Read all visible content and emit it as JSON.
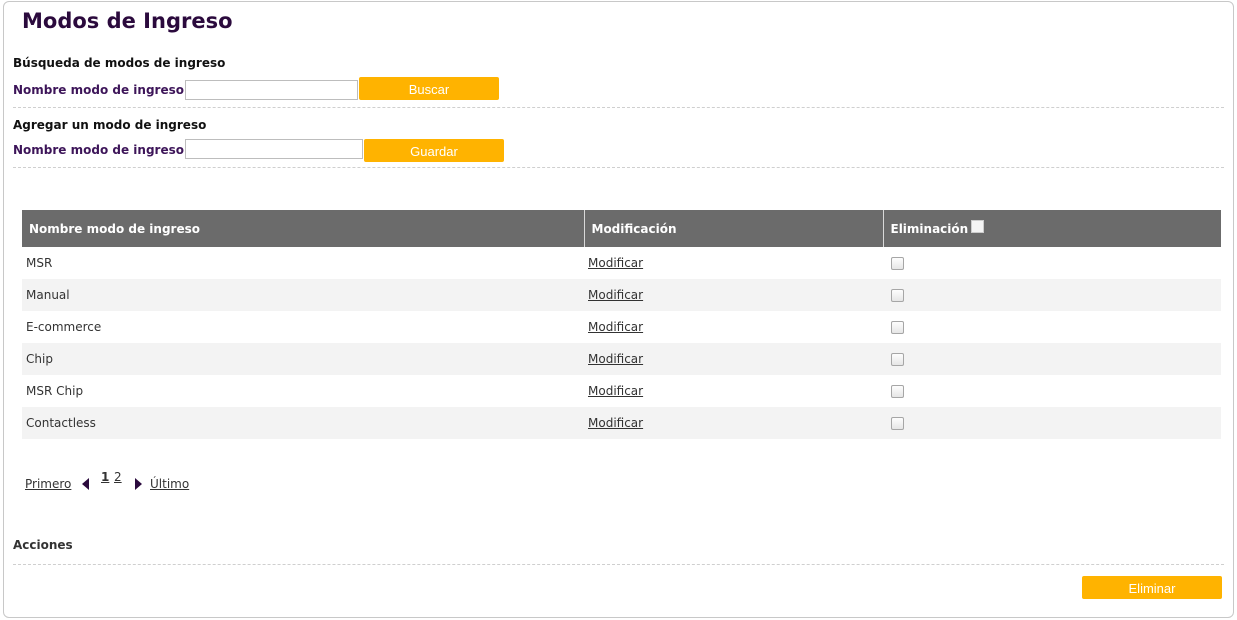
{
  "page": {
    "title": "Modos de Ingreso"
  },
  "search": {
    "section_title": "Búsqueda de modos de ingreso",
    "label": "Nombre modo de ingreso",
    "value": "",
    "button": "Buscar"
  },
  "add": {
    "section_title": "Agregar un modo de ingreso",
    "label": "Nombre modo de ingreso",
    "value": "",
    "button": "Guardar"
  },
  "table": {
    "headers": [
      "Nombre modo de ingreso",
      "Modificación",
      "Eliminación"
    ],
    "rows": [
      {
        "name": "MSR",
        "action": "Modificar",
        "checked": false
      },
      {
        "name": "Manual",
        "action": "Modificar",
        "checked": false
      },
      {
        "name": "E-commerce",
        "action": "Modificar",
        "checked": false
      },
      {
        "name": "Chip",
        "action": "Modificar",
        "checked": false
      },
      {
        "name": "MSR Chip",
        "action": "Modificar",
        "checked": false
      },
      {
        "name": "Contactless",
        "action": "Modificar",
        "checked": false
      }
    ]
  },
  "pagination": {
    "first": "Primero",
    "pages": [
      "1",
      "2"
    ],
    "current_page": "1",
    "last": "Último",
    "prev_icon": "triangle-left-icon",
    "next_icon": "triangle-right-icon"
  },
  "actions": {
    "title": "Acciones",
    "delete_button": "Eliminar"
  },
  "colors": {
    "accent": "#ffb300",
    "title": "#2b0a3d",
    "label": "#3d1559",
    "table_header": "#6b6b6b",
    "row_alt": "#f3f3f3"
  }
}
